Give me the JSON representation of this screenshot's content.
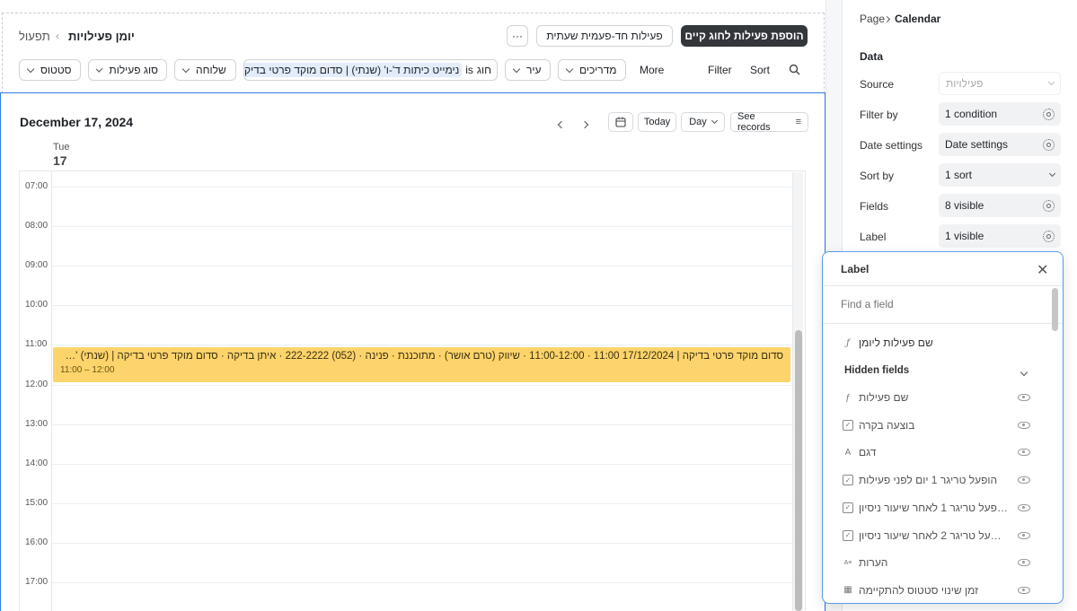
{
  "header": {
    "breadcrumb_current": "יומן פעילויות",
    "breadcrumb_parent": "תפעול",
    "primary_button": "הוספת פעילות לחוג קיים",
    "secondary_button": "פעילות חד-פעמית שעתית",
    "more_icon_label": "···"
  },
  "filters": [
    {
      "label": "סטטוס"
    },
    {
      "label": "סוג פעילות"
    },
    {
      "label": "שלוחה"
    }
  ],
  "filter_chip": {
    "field": "חוג",
    "operator": "is",
    "value": "נימייט כיתות ד'-ו' (שנתי) | סדום מוקד פרטי בדיקה"
  },
  "filters_right": [
    {
      "label": "עיר"
    },
    {
      "label": "מדריכים"
    }
  ],
  "toolbar": {
    "more": "More",
    "filter": "Filter",
    "sort": "Sort"
  },
  "calendar": {
    "date_title": "December 17, 2024",
    "today": "Today",
    "view": "Day",
    "see_records": "See records",
    "day_name": "Tue",
    "day_num": "17",
    "hours": [
      "07:00",
      "08:00",
      "09:00",
      "10:00",
      "11:00",
      "12:00",
      "13:00",
      "14:00",
      "15:00",
      "16:00",
      "17:00"
    ]
  },
  "event": {
    "title": "סדום מוקד פרטי בדיקה | 17/12/2024 11:00 · 11:00-12:00 · שיווק (טרם אושר) · מתוכננת · פנינה · (052) 222-2222 · איתן בדיקה · סדום מוקד פרטי בדיקה | (שנתי) '…",
    "time": "11:00 – 12:00",
    "color": "#fcd46b"
  },
  "panel": {
    "breadcrumb_parent": "Page",
    "breadcrumb_current": "Calendar",
    "section_title": "Data",
    "rows": [
      {
        "label": "Source",
        "value": "פעילויות"
      },
      {
        "label": "Filter by",
        "value": "1 condition"
      },
      {
        "label": "Date settings",
        "value": "Date settings"
      },
      {
        "label": "Sort by",
        "value": "1 sort"
      },
      {
        "label": "Fields",
        "value": "8 visible"
      },
      {
        "label": "Label",
        "value": "1 visible"
      }
    ]
  },
  "popover": {
    "title": "Label",
    "search_placeholder": "Find a field",
    "visible_field": "שם פעילות ליומן",
    "hidden_title": "Hidden fields",
    "hidden_fields": [
      {
        "label": "שם פעילות",
        "icon": "formula-icon"
      },
      {
        "label": "בוצעה בקרה",
        "icon": "checkbox-icon"
      },
      {
        "label": "דגם",
        "icon": "text-icon"
      },
      {
        "label": "הופעל טריגר 1 יום לפני פעילות",
        "icon": "checkbox-icon"
      },
      {
        "label": "…פעל טריגר 1 לאחר שיעור ניסיון",
        "icon": "checkbox-icon"
      },
      {
        "label": "…על טריגר 2 לאחר שיעור ניסיון",
        "icon": "checkbox-icon"
      },
      {
        "label": "הערות",
        "icon": "long-text-icon"
      },
      {
        "label": "זמן שינוי סטטוס להתקיימה",
        "icon": "date-icon"
      }
    ]
  }
}
